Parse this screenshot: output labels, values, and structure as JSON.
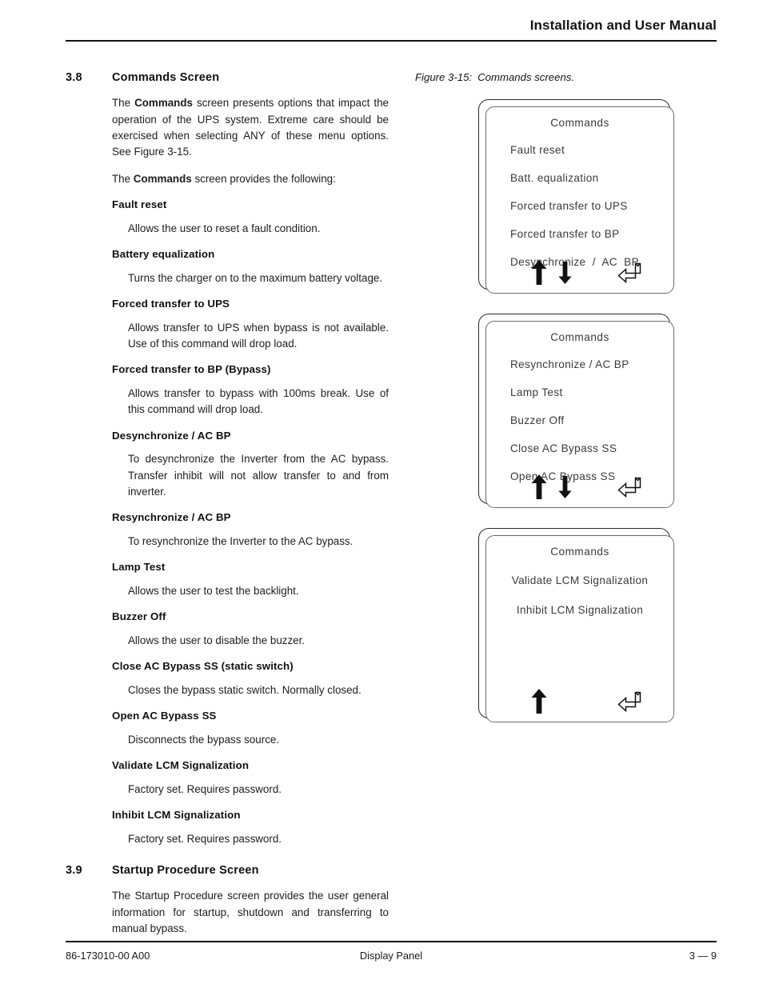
{
  "header": {
    "title": "Installation and User Manual"
  },
  "sections": [
    {
      "number": "3.8",
      "title": "Commands Screen",
      "intro_1_pre": "The ",
      "intro_1_bold": "Commands",
      "intro_1_post": " screen presents options that impact the operation of the UPS system. Extreme care should be exercised when selecting ANY of these menu options. See Figure 3-15.",
      "intro_2_pre": "The ",
      "intro_2_bold": "Commands",
      "intro_2_post": " screen provides the following:"
    },
    {
      "number": "3.9",
      "title": "Startup Procedure Screen",
      "intro_1": "The Startup Procedure screen provides the user general information for startup, shutdown and transferring to manual bypass."
    }
  ],
  "glossary": [
    {
      "term": "Fault reset",
      "definition": "Allows the user to reset a fault condition."
    },
    {
      "term": "Battery equalization",
      "definition": "Turns the charger on to the maximum battery voltage."
    },
    {
      "term": "Forced transfer to UPS",
      "definition": "Allows transfer to UPS when bypass is not available. Use of this command will drop load."
    },
    {
      "term": "Forced transfer to BP (Bypass)",
      "definition": "Allows transfer to bypass with 100ms break. Use of this command will drop load."
    },
    {
      "term": "Desynchronize / AC BP",
      "definition": "To desynchronize the Inverter from the AC bypass. Transfer inhibit will not allow transfer to and from inverter."
    },
    {
      "term": "Resynchronize / AC BP",
      "definition": "To resynchronize the Inverter to the AC bypass."
    },
    {
      "term": "Lamp Test",
      "definition": "Allows the user to test the backlight."
    },
    {
      "term": "Buzzer Off",
      "definition": "Allows the user to disable the buzzer."
    },
    {
      "term": "Close AC Bypass SS (static switch)",
      "definition": "Closes the bypass static switch. Normally closed."
    },
    {
      "term": "Open AC Bypass SS",
      "definition": "Disconnects the bypass source."
    },
    {
      "term": "Validate LCM Signalization",
      "definition": "Factory set. Requires password."
    },
    {
      "term": "Inhibit LCM Signalization",
      "definition": "Factory set. Requires password."
    }
  ],
  "figure": {
    "label": "Figure 3-15:",
    "caption": "Commands screens.",
    "panels": [
      {
        "title": "Commands",
        "items": [
          "Fault reset",
          "Batt. equalization",
          "Forced transfer to UPS",
          "Forced transfer to BP",
          "Desynchronize  /  AC  BP"
        ],
        "icons": [
          "up-arrow-icon",
          "down-arrow-icon",
          "enter-arrow-icon"
        ]
      },
      {
        "title": "Commands",
        "items": [
          "Resynchronize / AC BP",
          "Lamp Test",
          "Buzzer Off",
          "Close AC Bypass SS",
          "Open AC Bypass SS"
        ],
        "icons": [
          "up-arrow-icon",
          "down-arrow-icon",
          "enter-arrow-icon"
        ]
      },
      {
        "title": "Commands",
        "items": [
          "Validate LCM Signalization",
          "Inhibit LCM Signalization"
        ],
        "icons": [
          "up-arrow-icon",
          "enter-arrow-icon"
        ]
      }
    ]
  },
  "footer": {
    "document_number": "86-173010-00 A00",
    "chapter_name": "Display Panel",
    "page_number": "3 — 9"
  }
}
